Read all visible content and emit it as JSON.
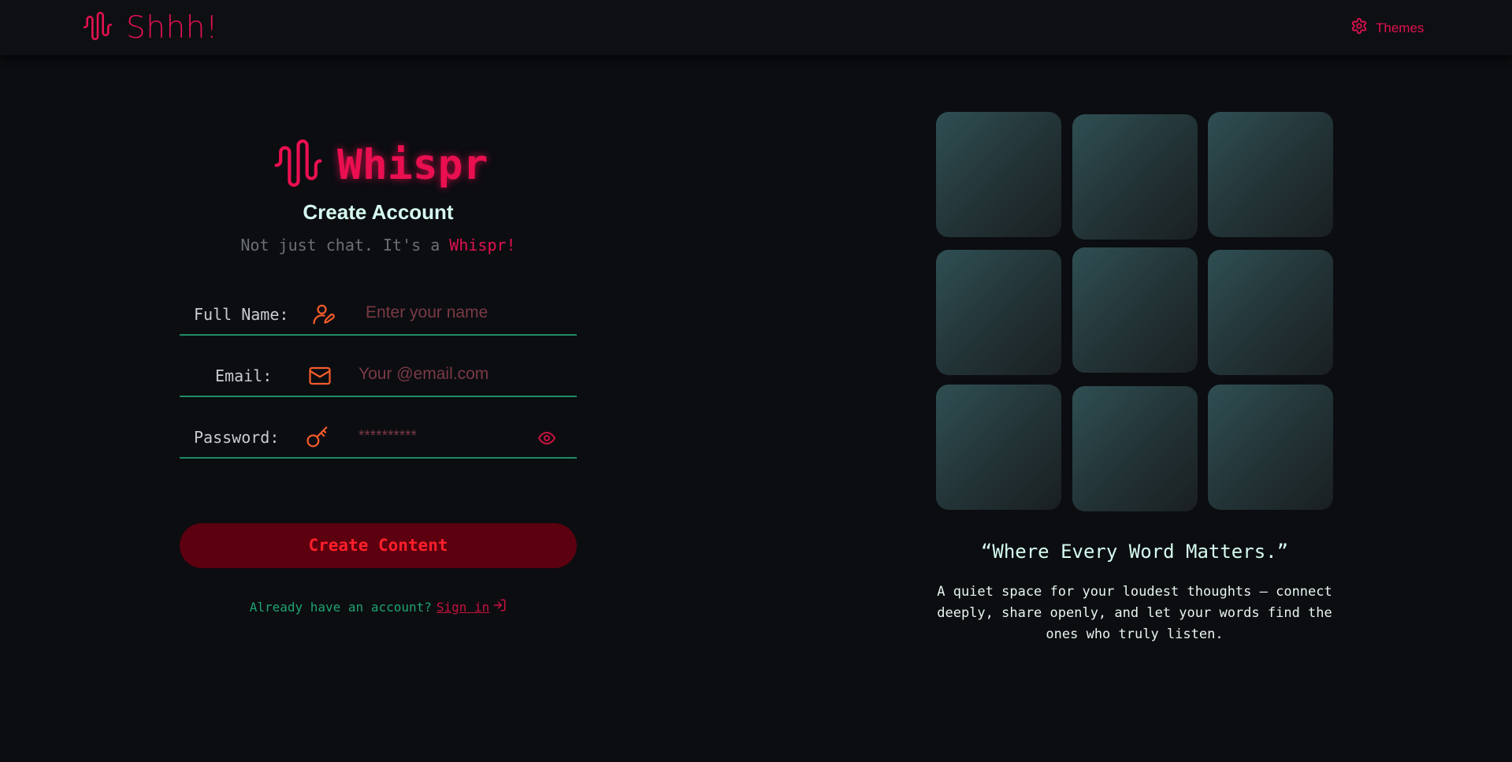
{
  "navbar": {
    "brand": "Shhh!",
    "brand_icon": "soundwave-icon",
    "themes_label": "Themes",
    "themes_icon": "gear-icon"
  },
  "form": {
    "logo_text": "Whispr",
    "logo_icon": "soundwave-icon",
    "title": "Create Account",
    "subtitle_prefix": "Not just chat. It's a ",
    "subtitle_accent": "Whispr!",
    "fields": {
      "name": {
        "label": "Full Name:",
        "placeholder": "Enter your name",
        "icon": "user-edit-icon"
      },
      "email": {
        "label": "Email:",
        "placeholder": "Your @email.com",
        "icon": "mail-icon"
      },
      "password": {
        "label": "Password:",
        "placeholder": "**********",
        "icon": "key-icon",
        "toggle_icon": "eye-icon"
      }
    },
    "submit_label": "Create Content",
    "signin_question": "Already have an account?",
    "signin_link": "Sign in",
    "signin_icon": "log-in-icon"
  },
  "showcase": {
    "quote": "“Where Every Word Matters.”",
    "description_lines": [
      "A quiet space for your loudest thoughts — connect",
      "deeply, share openly, and let your words find the",
      "ones who truly listen."
    ]
  },
  "colors": {
    "background": "#0b0d11",
    "accent": "#e1114f",
    "field_underline": "#1e8b65",
    "icon_orange": "#f25c2a",
    "button_bg": "#5c000f",
    "button_text": "#ff1f2b",
    "signin_question": "#1fa370"
  }
}
